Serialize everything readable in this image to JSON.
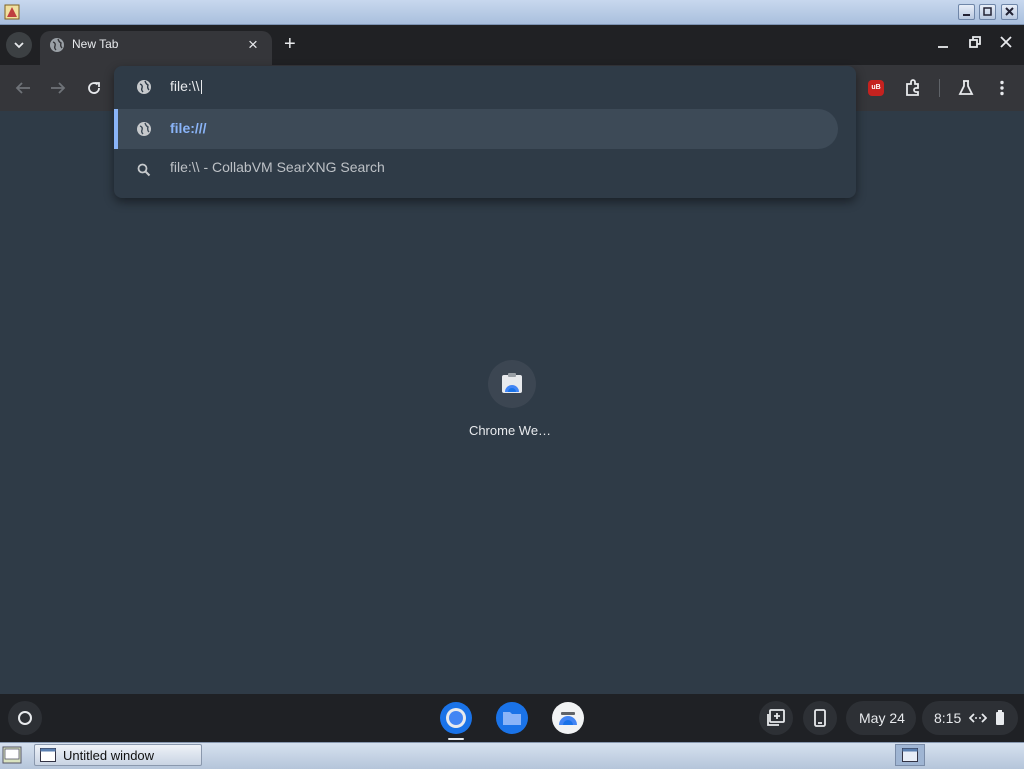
{
  "outer_window": {
    "title": ""
  },
  "browser": {
    "tab": {
      "title": "New Tab",
      "close_symbol": "×"
    },
    "new_tab_symbol": "+",
    "omnibox": {
      "input_value": "file:\\\\",
      "suggestions": [
        {
          "icon": "globe-icon",
          "text": "file:///"
        },
        {
          "icon": "search-icon",
          "text": "file:\\\\ - CollabVM SearXNG Search"
        }
      ]
    },
    "extensions": [
      {
        "name": "ublock-icon",
        "badge": "uB",
        "color": "#c5221f"
      },
      {
        "name": "puzzle-icon"
      },
      {
        "name": "flask-icon"
      }
    ],
    "accent_color": "#8ab4f8"
  },
  "new_tab_page": {
    "shortcuts": [
      {
        "label": "Chrome We…"
      }
    ]
  },
  "shelf": {
    "apps": [
      "chrome-icon",
      "files-icon",
      "web-store-icon"
    ],
    "date": "May 24",
    "time": "8:15"
  },
  "taskbar": {
    "window_button": "Untitled window"
  }
}
